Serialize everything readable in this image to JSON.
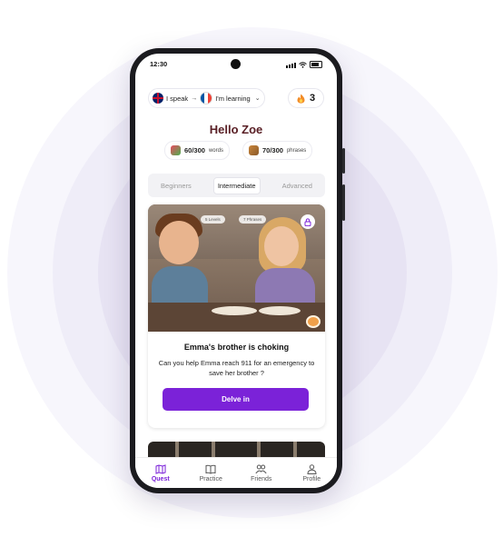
{
  "status_bar": {
    "time": "12:30"
  },
  "language": {
    "speak_label": "I speak",
    "learning_label": "I'm learning"
  },
  "streak": {
    "count": "3"
  },
  "greeting": "Hello Zoe",
  "stats": {
    "words": {
      "value": "60/300",
      "unit": "words"
    },
    "phrases": {
      "value": "70/300",
      "unit": "phrases"
    }
  },
  "levels": {
    "tabs": [
      "Beginners",
      "Intermediate",
      "Advanced"
    ],
    "selected": "Intermediate"
  },
  "story_card": {
    "levels_badge": "5 Levels",
    "phrases_badge": "7 Phrases",
    "title": "Emma's brother is choking",
    "description": "Can you help Emma reach 911 for an emergency to save her brother ?",
    "button_label": "Delve in"
  },
  "bottom_nav": {
    "items": [
      {
        "label": "Quest",
        "icon": "map-icon",
        "active": true
      },
      {
        "label": "Practice",
        "icon": "book-icon",
        "active": false
      },
      {
        "label": "Friends",
        "icon": "friends-icon",
        "active": false
      },
      {
        "label": "Profile",
        "icon": "person-icon",
        "active": false
      }
    ]
  },
  "colors": {
    "accent": "#7b22d8",
    "greeting": "#5a2026"
  }
}
